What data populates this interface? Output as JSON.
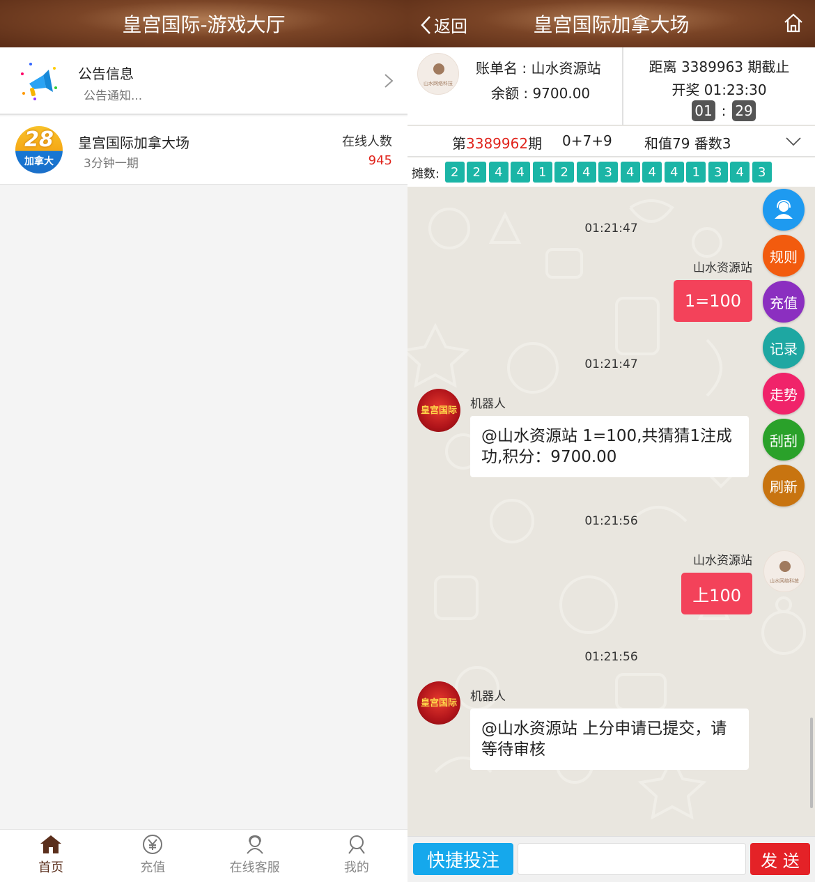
{
  "lobby": {
    "title": "皇宫国际-游戏大厅",
    "notice": {
      "title": "公告信息",
      "subtitle": "公告通知..."
    },
    "game": {
      "logo_number": "28",
      "logo_caption": "加拿大",
      "name": "皇宫国际加拿大场",
      "period": "3分钟一期",
      "online_label": "在线人数",
      "online_count": "945"
    },
    "tabs": [
      {
        "label": "首页",
        "icon": "home-icon"
      },
      {
        "label": "充值",
        "icon": "yen-icon"
      },
      {
        "label": "在线客服",
        "icon": "support-icon"
      },
      {
        "label": "我的",
        "icon": "user-icon"
      }
    ]
  },
  "room": {
    "back_label": "返回",
    "title": "皇宫国际加拿大场",
    "account": {
      "name_text": "账单名 : 山水资源站",
      "balance_text": "余额 : 9700.00",
      "distance_text": "距离 3389963 期截止",
      "open_text": "开奖 01:23:30",
      "timer_min": "01",
      "timer_sep": ":",
      "timer_sec": "29"
    },
    "issue": {
      "prefix": "第",
      "number": "3389962",
      "suffix": "期",
      "formula": "0+7+9",
      "sum_text": "和值79 番数3"
    },
    "tan": {
      "label": "摊数:",
      "values": [
        "2",
        "2",
        "4",
        "4",
        "1",
        "2",
        "4",
        "3",
        "4",
        "4",
        "4",
        "1",
        "3",
        "4",
        "3"
      ]
    },
    "avatar_text": "山水网络科技",
    "bot_avatar_text": "皇宫国际",
    "messages": [
      {
        "time": "01:21:47",
        "sender": "山水资源站",
        "text": "1=100"
      },
      {
        "time": "01:21:47",
        "sender": "机器人",
        "text": "@山水资源站 1=100,共猜猜1注成功,积分：9700.00"
      },
      {
        "time": "01:21:56",
        "sender": "山水资源站",
        "text": "上100"
      },
      {
        "time": "01:21:56",
        "sender": "机器人",
        "text": "@山水资源站 上分申请已提交，请等待审核"
      }
    ],
    "side_buttons": [
      {
        "label": "",
        "icon": "customer-service-icon",
        "color": "#1e9af0"
      },
      {
        "label": "规则",
        "color": "#f25b0e"
      },
      {
        "label": "充值",
        "color": "#8b2fc0"
      },
      {
        "label": "记录",
        "color": "#1ea7a2"
      },
      {
        "label": "走势",
        "color": "#f0236a"
      },
      {
        "label": "刮刮",
        "color": "#2aa12a"
      },
      {
        "label": "刷新",
        "color": "#c87410"
      }
    ],
    "quick_bet_label": "快捷投注",
    "input_value": "",
    "send_label": "发 送"
  }
}
